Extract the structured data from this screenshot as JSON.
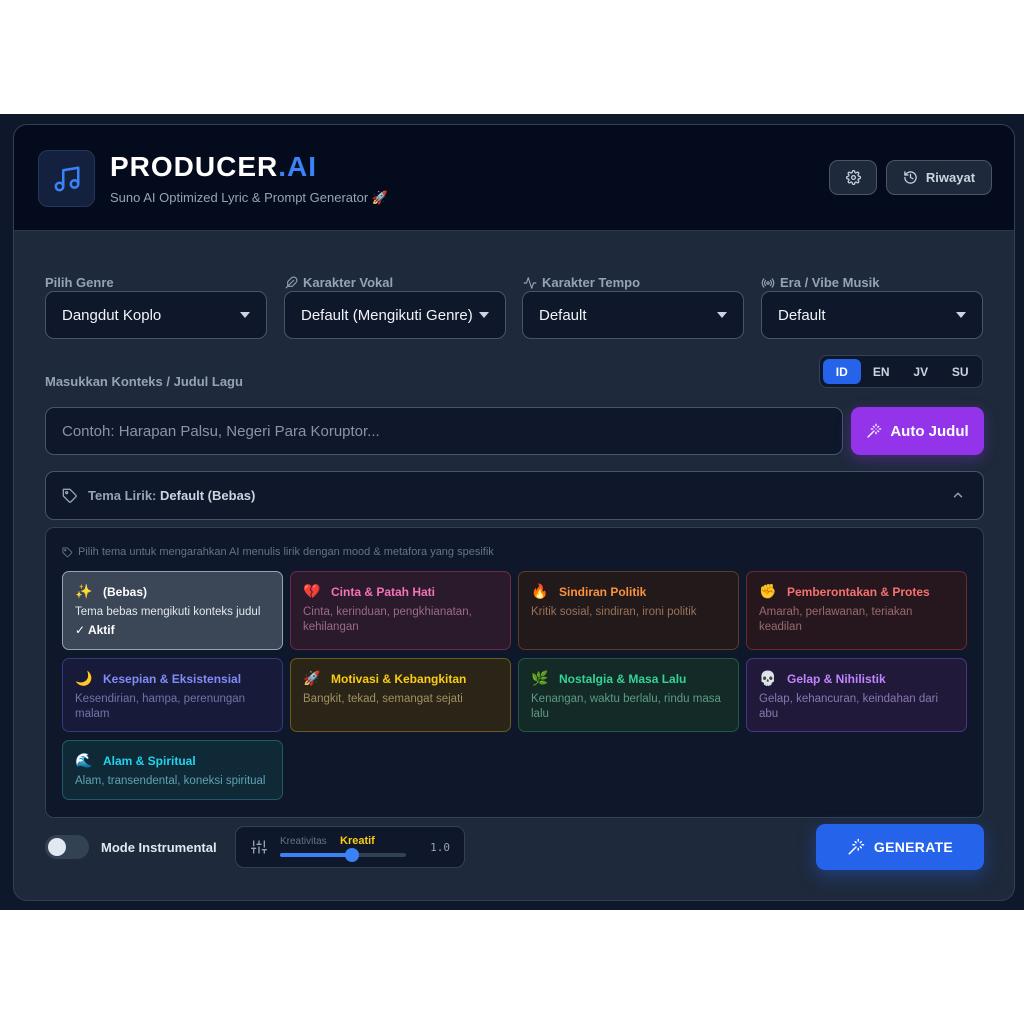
{
  "header": {
    "brand_main": "PRODUCER",
    "brand_accent": ".AI",
    "tagline": "Suno AI Optimized Lyric & Prompt Generator 🚀",
    "settings_icon": "gear-icon",
    "history_label": "Riwayat"
  },
  "selectors": {
    "genre": {
      "label": "Pilih Genre",
      "value": "Dangdut Koplo"
    },
    "vocal": {
      "label": "Karakter Vokal",
      "value": "Default (Mengikuti Genre)"
    },
    "tempo": {
      "label": "Karakter Tempo",
      "value": "Default"
    },
    "era": {
      "label": "Era / Vibe Musik",
      "value": "Default"
    }
  },
  "context": {
    "label": "Masukkan Konteks / Judul Lagu",
    "placeholder": "Contoh: Harapan Palsu, Negeri Para Koruptor...",
    "languages": [
      "ID",
      "EN",
      "JV",
      "SU"
    ],
    "active_language": "ID",
    "auto_title_label": "Auto Judul"
  },
  "theme": {
    "header_label": "Tema Lirik:",
    "header_value": "Default (Bebas)",
    "hint": "Pilih tema untuk mengarahkan AI menulis lirik dengan mood & metafora yang spesifik",
    "active_tag": "✓ Aktif",
    "cards": [
      {
        "emoji": "✨",
        "title": "(Bebas)",
        "desc": "Tema bebas mengikuti konteks judul"
      },
      {
        "emoji": "💔",
        "title": "Cinta & Patah Hati",
        "desc": "Cinta, kerinduan, pengkhianatan, kehilangan"
      },
      {
        "emoji": "🔥",
        "title": "Sindiran Politik",
        "desc": "Kritik sosial, sindiran, ironi politik"
      },
      {
        "emoji": "✊",
        "title": "Pemberontakan & Protes",
        "desc": "Amarah, perlawanan, teriakan keadilan"
      },
      {
        "emoji": "🌙",
        "title": "Kesepian & Eksistensial",
        "desc": "Kesendirian, hampa, perenungan malam"
      },
      {
        "emoji": "🚀",
        "title": "Motivasi & Kebangkitan",
        "desc": "Bangkit, tekad, semangat sejati"
      },
      {
        "emoji": "🌿",
        "title": "Nostalgia & Masa Lalu",
        "desc": "Kenangan, waktu berlalu, rindu masa lalu"
      },
      {
        "emoji": "💀",
        "title": "Gelap & Nihilistik",
        "desc": "Gelap, kehancuran, keindahan dari abu"
      },
      {
        "emoji": "🌊",
        "title": "Alam & Spiritual",
        "desc": "Alam, transendental, koneksi spiritual"
      }
    ]
  },
  "footer": {
    "instrumental_label": "Mode Instrumental",
    "instrumental_on": false,
    "creativity_label": "Kreativitas",
    "creativity_mode": "Kreatif",
    "creativity_value": "1.0",
    "creativity_fraction": 0.57,
    "generate_label": "GENERATE"
  },
  "colors": {
    "background": "#1e293b",
    "accent_blue": "#3b82f6",
    "accent_purple": "#9333ea"
  }
}
